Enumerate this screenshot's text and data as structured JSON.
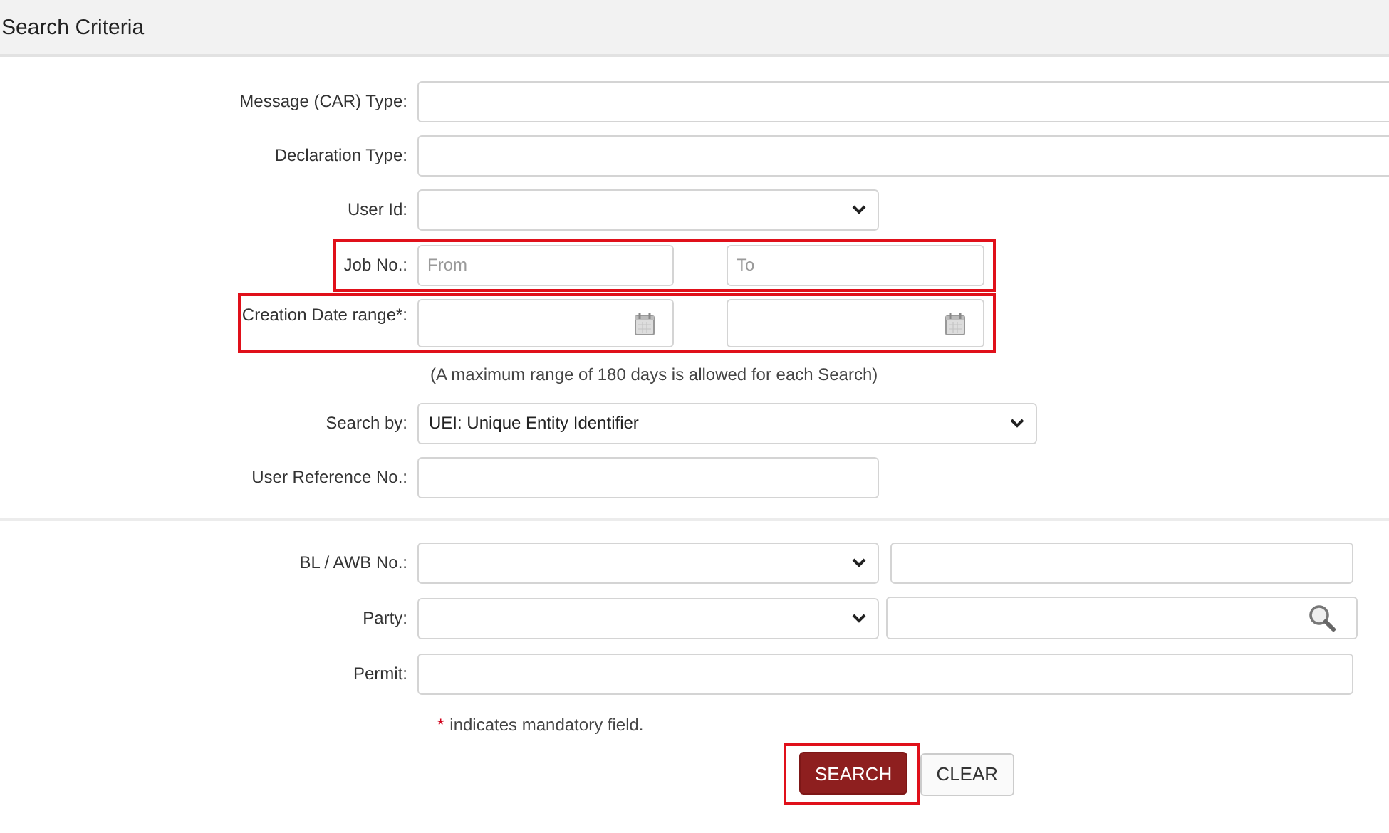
{
  "header": {
    "title": "Search Criteria"
  },
  "rows": [
    {
      "kind": "long_text",
      "label": "Message (CAR) Type:"
    },
    {
      "kind": "long_text",
      "label": "Declaration Type:"
    },
    {
      "kind": "select",
      "label": "User Id:"
    },
    {
      "kind": "range",
      "label": "Job No.:",
      "from_placeholder": "From",
      "to_placeholder": "To",
      "highlighted": true
    },
    {
      "kind": "date_range",
      "label": "Creation Date range*:",
      "highlighted": true
    },
    {
      "kind": "note",
      "text": "(A maximum range of 180 days is allowed for each Search)"
    },
    {
      "kind": "select",
      "label": "Search by:",
      "value": "UEI: Unique Entity Identifier"
    },
    {
      "kind": "text",
      "label": "User Reference No.:"
    },
    {
      "kind": "divider"
    },
    {
      "kind": "select_text",
      "label": "BL / AWB No.:"
    },
    {
      "kind": "select_search",
      "label": "Party:"
    },
    {
      "kind": "full_text",
      "label": "Permit:"
    }
  ],
  "mandatory_note": {
    "marker": "*",
    "text": "indicates mandatory field."
  },
  "buttons": [
    {
      "label": "SEARCH",
      "kind": "primary",
      "highlighted": true
    },
    {
      "label": "CLEAR",
      "kind": "secondary"
    }
  ]
}
